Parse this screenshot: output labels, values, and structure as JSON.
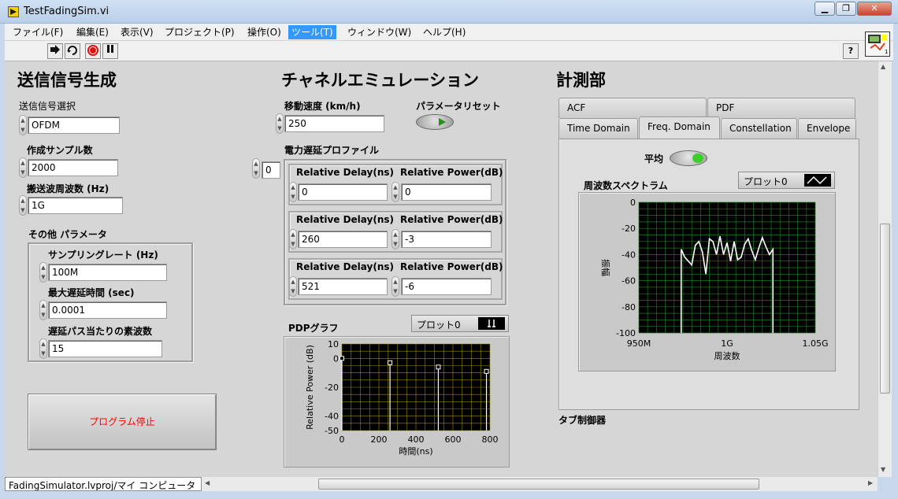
{
  "window": {
    "title": "TestFadingSim.vi",
    "min_glyph": "▁",
    "max_glyph": "❐",
    "close_glyph": "✕"
  },
  "menu": [
    "ファイル(F)",
    "編集(E)",
    "表示(V)",
    "プロジェクト(P)",
    "操作(O)",
    "ツール(T)",
    "ウィンドウ(W)",
    "ヘルプ(H)"
  ],
  "menu_active": "ツール(T)",
  "toolbar": {
    "help": "?"
  },
  "tx": {
    "heading": "送信信号生成",
    "signal_label": "送信信号選択",
    "signal_value": "OFDM",
    "samples_label": "作成サンプル数",
    "samples_value": "2000",
    "carrier_label": "搬送波周波数 (Hz)",
    "carrier_value": "1G",
    "other_label": "その他 パラメータ",
    "sample_rate_label": "サンプリングレート (Hz)",
    "sample_rate_value": "100M",
    "max_delay_label": "最大遅延時間 (sec)",
    "max_delay_value": "0.0001",
    "waves_label": "遅延パス当たりの素波数",
    "waves_value": "15",
    "stop_button": "プログラム停止"
  },
  "channel": {
    "heading": "チャネルエミュレーション",
    "speed_label": "移動速度 (km/h)",
    "speed_value": "250",
    "reset_label": "パラメータリセット",
    "profile_label": "電力遅延プロファイル",
    "index_value": "0",
    "delay_col": "Relative Delay(ns)",
    "power_col": "Relative Power(dB)",
    "rows": [
      {
        "delay": "0",
        "power": "0"
      },
      {
        "delay": "260",
        "power": "-3"
      },
      {
        "delay": "521",
        "power": "-6"
      }
    ],
    "pdp_label": "PDPグラフ",
    "pdp_legend": "プロット0"
  },
  "measure": {
    "heading": "計測部",
    "tabs_top": [
      "ACF",
      "PDF"
    ],
    "tabs_bottom": [
      "Time Domain",
      "Freq. Domain",
      "Constellation",
      "Envelope"
    ],
    "active_tab": "Freq. Domain",
    "avg_label": "平均",
    "spectrum_label": "周波数スペクトラム",
    "spectrum_legend": "プロット0",
    "tab_control_label": "タブ制御器"
  },
  "status": {
    "path": "FadingSimulator.lvproj/マイ コンピュータ"
  },
  "colors": {
    "plot_bg": "#000000",
    "grid": "#1f7a1f",
    "pdp_grid": "#9a8a00",
    "trace": "#ffffff",
    "stop_text": "#ff0000",
    "led_on": "#3ccf2a"
  },
  "chart_data": [
    {
      "type": "scatter",
      "title": "PDPグラフ",
      "xlabel": "時間(ns)",
      "ylabel": "Relative Power (dB)",
      "xlim": [
        0,
        800
      ],
      "ylim": [
        -50,
        10
      ],
      "x_ticks": [
        "0",
        "200",
        "400",
        "600",
        "800"
      ],
      "y_ticks": [
        "10",
        "0",
        "-20",
        "-40",
        "-50"
      ],
      "series": [
        {
          "name": "プロット0",
          "x": [
            0,
            260,
            521,
            781
          ],
          "y": [
            0,
            -3,
            -6,
            -9
          ]
        }
      ]
    },
    {
      "type": "line",
      "title": "周波数スペクトラム",
      "xlabel": "周波数",
      "ylabel": "振幅",
      "x_ticks": [
        "950M",
        "1G",
        "1.05G"
      ],
      "y_ticks": [
        "0",
        "-20",
        "-40",
        "-60",
        "-80",
        "-100"
      ],
      "xlim": [
        950,
        1050
      ],
      "ylim": [
        -100,
        0
      ],
      "series": [
        {
          "name": "プロット0",
          "x": [
            974,
            976,
            978,
            980,
            982,
            984,
            986,
            988,
            990,
            992,
            994,
            996,
            998,
            1000,
            1002,
            1004,
            1006,
            1008,
            1010,
            1012,
            1014,
            1016,
            1018,
            1020,
            1022,
            1024,
            1026
          ],
          "y": [
            -36,
            -42,
            -45,
            -48,
            -33,
            -30,
            -38,
            -55,
            -28,
            -30,
            -40,
            -26,
            -40,
            -31,
            -45,
            -30,
            -44,
            -42,
            -32,
            -28,
            -37,
            -44,
            -35,
            -27,
            -34,
            -40,
            -36
          ]
        }
      ]
    }
  ]
}
